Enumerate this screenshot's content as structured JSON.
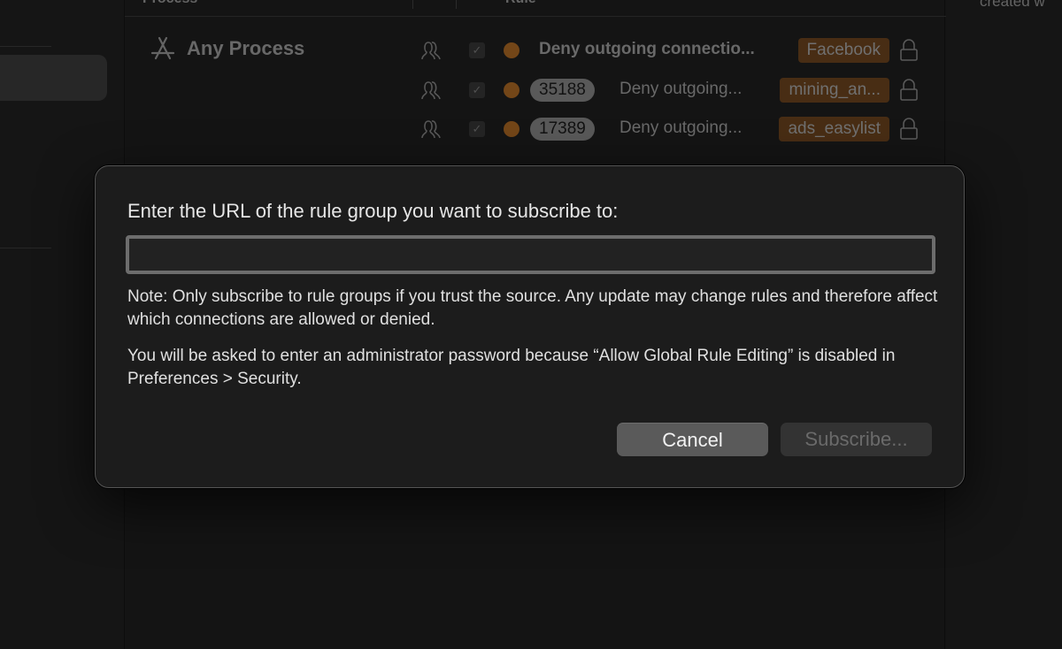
{
  "table": {
    "columns": [
      {
        "label": "Process"
      },
      {
        "label": "Rule"
      }
    ],
    "process": {
      "name": "Any Process",
      "icon": "app-store-icon"
    },
    "rules": [
      {
        "count": null,
        "text": "Deny outgoing connectio...",
        "bold": true,
        "group": "Facebook",
        "enabled": true,
        "status_color": "#7a4a1a",
        "locked": true
      },
      {
        "count": "35188",
        "text": "Deny outgoing...",
        "bold": false,
        "group": "mining_an...",
        "enabled": true,
        "status_color": "#7a4a1a",
        "locked": true
      },
      {
        "count": "17389",
        "text": "Deny outgoing...",
        "bold": false,
        "group": "ads_easylist",
        "enabled": true,
        "status_color": "#7a4a1a",
        "locked": true
      }
    ]
  },
  "inspector": {
    "created_label": "created w"
  },
  "dialog": {
    "prompt": "Enter the URL of the rule group you want to subscribe to:",
    "url_value": "",
    "url_placeholder": "",
    "note": "Note: Only subscribe to rule groups if you trust the source. Any update may change rules and therefore affect which connections are allowed or denied.",
    "admin_note": "You will be asked to enter an administrator password because “Allow Global Rule Editing” is disabled in Preferences > Security.",
    "cancel_label": "Cancel",
    "subscribe_label": "Subscribe...",
    "subscribe_enabled": false
  },
  "colors": {
    "accent_tag": "#4c3016",
    "status_dot": "#7a4a1a"
  }
}
